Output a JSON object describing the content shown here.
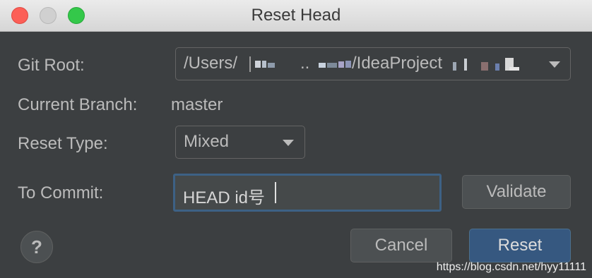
{
  "window": {
    "title": "Reset Head"
  },
  "form": {
    "git_root": {
      "label": "Git Root:",
      "value_part1": "/Users/",
      "value_part2": "..",
      "value_part3": "/IdeaProject"
    },
    "current_branch": {
      "label": "Current Branch:",
      "value": "master"
    },
    "reset_type": {
      "label": "Reset Type:",
      "value": "Mixed"
    },
    "to_commit": {
      "label": "To Commit:",
      "value": "HEAD id号"
    }
  },
  "buttons": {
    "validate": "Validate",
    "cancel": "Cancel",
    "reset": "Reset",
    "help": "?"
  },
  "watermark": "https://blog.csdn.net/hyy11111",
  "colors": {
    "background": "#3c3f41",
    "accent": "#365880",
    "focus_border": "#3d6185"
  }
}
